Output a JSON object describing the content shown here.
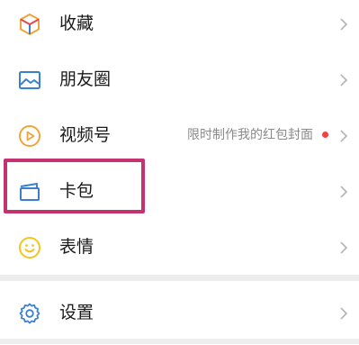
{
  "menu": {
    "items": [
      {
        "label": "收藏",
        "icon": "favorites-cube-icon"
      },
      {
        "label": "朋友圈",
        "icon": "moments-picture-icon"
      },
      {
        "label": "视频号",
        "icon": "channels-play-icon",
        "extra": "限时制作我的红包封面",
        "badge": "red-dot"
      },
      {
        "label": "卡包",
        "icon": "card-wallet-icon",
        "highlighted": true
      },
      {
        "label": "表情",
        "icon": "sticker-smile-icon"
      },
      {
        "label": "设置",
        "icon": "settings-gear-icon"
      }
    ]
  },
  "colors": {
    "highlight_border": "#c4336f",
    "badge_red": "#f24141",
    "icon_blue": "#3b7fd1",
    "icon_orange": "#f0a43a",
    "icon_yellow": "#f5c518"
  }
}
